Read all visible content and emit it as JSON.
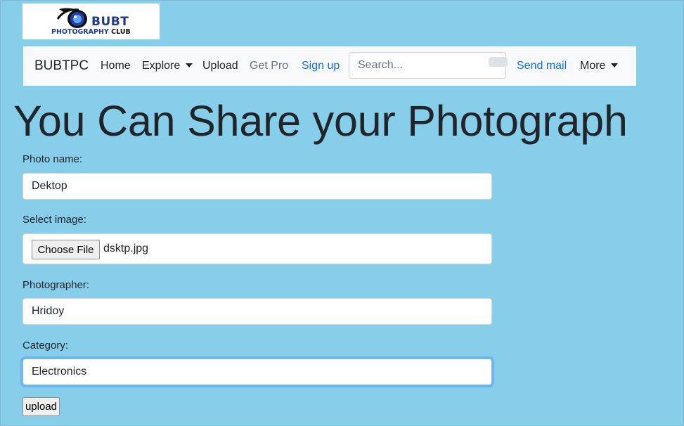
{
  "logo": {
    "line1": "BUBT",
    "line2": "PHOTOGRAPHY",
    "line3": "CLUB"
  },
  "navbar": {
    "brand": "BUBTPC",
    "home": "Home",
    "explore": "Explore",
    "upload": "Upload",
    "get_pro": "Get Pro",
    "sign_up": "Sign up",
    "search_placeholder": "Search...",
    "send_mail": "Send mail",
    "more": "More"
  },
  "heading": "You Can Share your Photograph",
  "form": {
    "photo_name_label": "Photo name:",
    "photo_name_value": "Dektop",
    "select_image_label": "Select image:",
    "choose_file_label": "Choose File",
    "file_name": "dsktp.jpg",
    "photographer_label": "Photographer:",
    "photographer_value": "Hridoy",
    "category_label": "Category:",
    "category_value": "Electronics",
    "upload_button": "upload"
  }
}
